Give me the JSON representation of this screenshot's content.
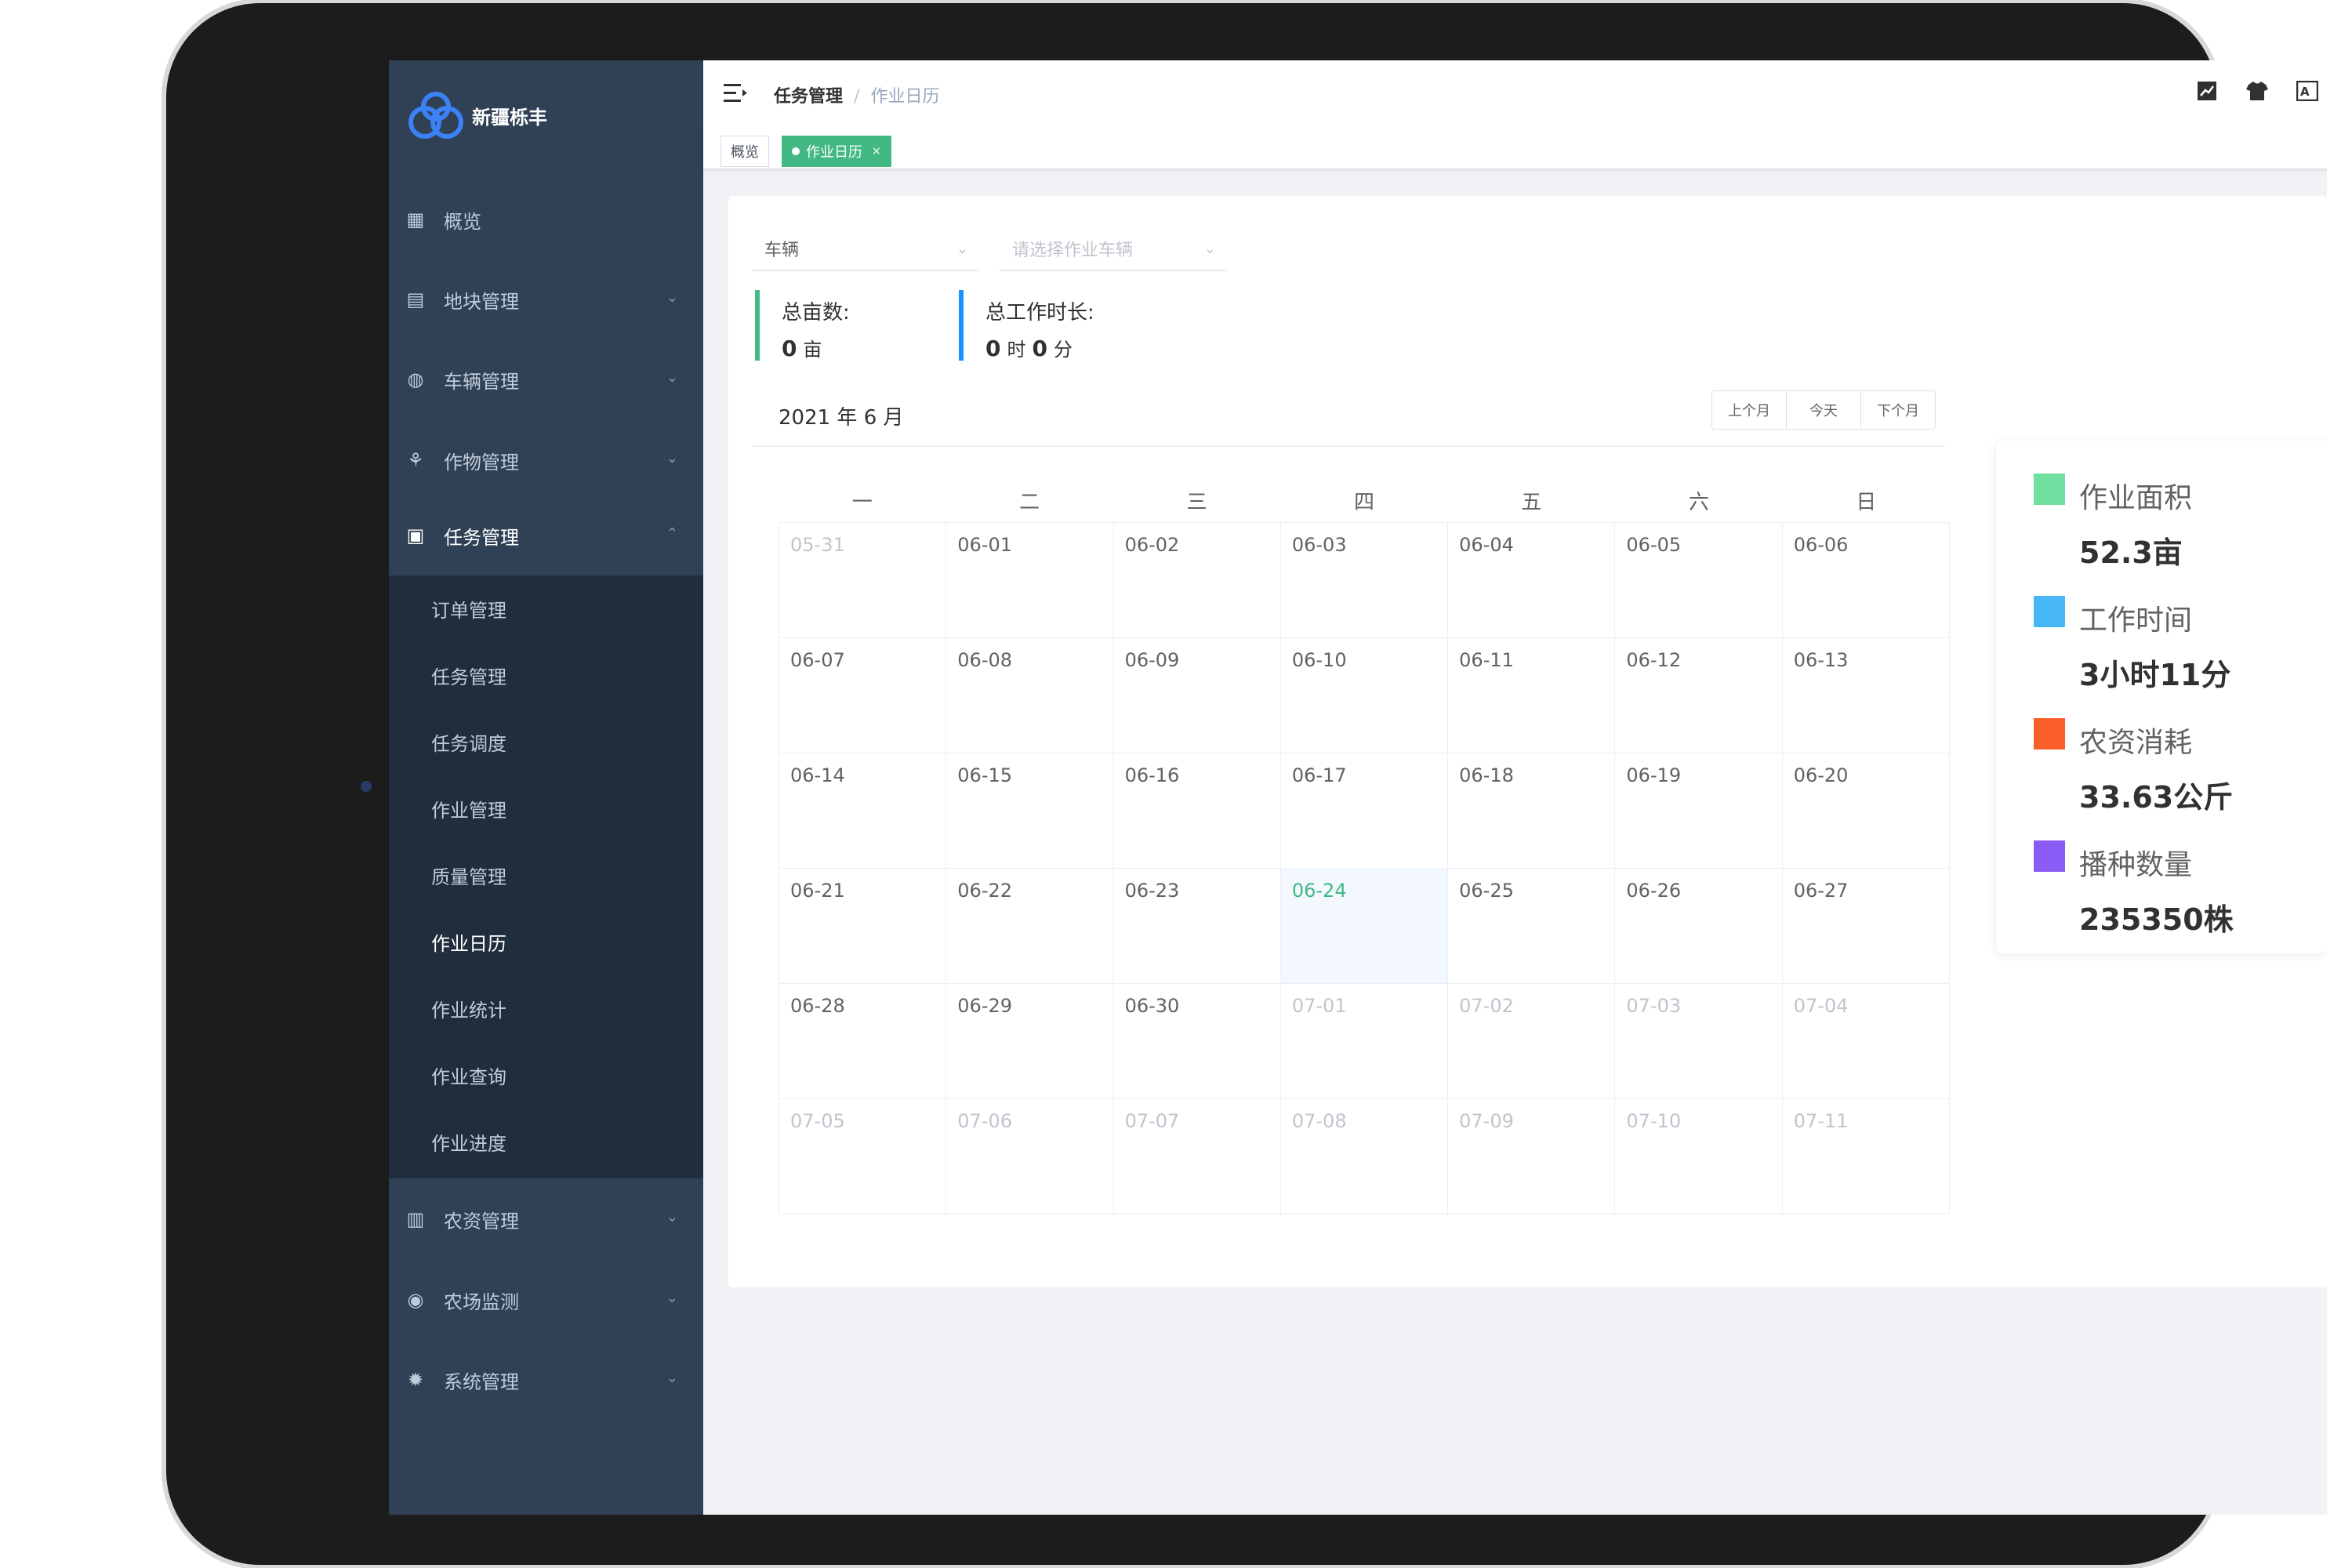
{
  "sidebar": {
    "logo_text": "新疆栎丰",
    "menu": [
      {
        "label": "概览",
        "icon": "dashboard-icon"
      },
      {
        "label": "地块管理",
        "icon": "grid-icon"
      },
      {
        "label": "车辆管理",
        "icon": "steering-wheel-icon"
      },
      {
        "label": "作物管理",
        "icon": "sprout-icon"
      },
      {
        "label": "任务管理",
        "icon": "clipboard-icon"
      },
      {
        "label": "农资管理",
        "icon": "warehouse-icon"
      },
      {
        "label": "农场监测",
        "icon": "location-icon"
      },
      {
        "label": "系统管理",
        "icon": "gear-icon"
      }
    ],
    "submenu": [
      "订单管理",
      "任务管理",
      "任务调度",
      "作业管理",
      "质量管理",
      "作业日历",
      "作业统计",
      "作业查询",
      "作业进度"
    ]
  },
  "navbar": {
    "breadcrumb_parent": "任务管理",
    "breadcrumb_sep": "/",
    "breadcrumb_current": "作业日历"
  },
  "tags": {
    "overview": "概览",
    "current": "作业日历",
    "close": "×"
  },
  "filters": {
    "vehicle_value": "车辆",
    "vehicle_arrow": "⌄",
    "work_vehicle_placeholder": "请选择作业车辆",
    "work_vehicle_arrow": "⌄"
  },
  "stats": {
    "total_area_label": "总亩数:",
    "total_area_value": "0",
    "total_area_unit": "亩",
    "total_time_label": "总工作时长:",
    "total_time_hours": "0",
    "total_time_hour_unit": "时",
    "total_time_minutes": "0",
    "total_time_minute_unit": "分"
  },
  "calendar": {
    "title": "2021 年 6 月",
    "prev_month": "上个月",
    "today": "今天",
    "next_month": "下个月",
    "weekdays": [
      "一",
      "二",
      "三",
      "四",
      "五",
      "六",
      "日"
    ],
    "weeks": [
      [
        "05-31",
        "06-01",
        "06-02",
        "06-03",
        "06-04",
        "06-05",
        "06-06"
      ],
      [
        "06-07",
        "06-08",
        "06-09",
        "06-10",
        "06-11",
        "06-12",
        "06-13"
      ],
      [
        "06-14",
        "06-15",
        "06-16",
        "06-17",
        "06-18",
        "06-19",
        "06-20"
      ],
      [
        "06-21",
        "06-22",
        "06-23",
        "06-24",
        "06-25",
        "06-26",
        "06-27"
      ],
      [
        "06-28",
        "06-29",
        "06-30",
        "07-01",
        "07-02",
        "07-03",
        "07-04"
      ],
      [
        "07-05",
        "07-06",
        "07-07",
        "07-08",
        "07-09",
        "07-10",
        "07-11"
      ]
    ],
    "today_date": "06-24"
  },
  "legend": [
    {
      "label": "作业面积",
      "value": "52.3亩",
      "color": "#6fe0a0"
    },
    {
      "label": "工作时间",
      "value": "3小时11分",
      "color": "#47b8f5"
    },
    {
      "label": "农资消耗",
      "value": "33.63公斤",
      "color": "#fa5f2a"
    },
    {
      "label": "播种数量",
      "value": "235350株",
      "color": "#8a5cf5"
    }
  ],
  "colors": {
    "sidebar_bg": "#304156",
    "submenu_bg": "#1f2d3d",
    "accent": "#42b983",
    "stat_bar_1": "#42b983",
    "stat_bar_2": "#1890ff"
  }
}
